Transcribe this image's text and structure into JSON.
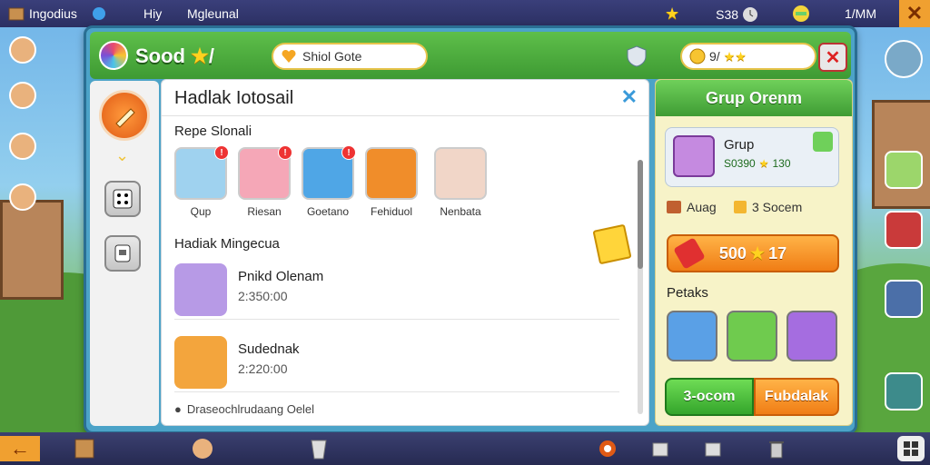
{
  "topbar": {
    "left_label": "Ingodius",
    "mid_label": "Hiy",
    "center_label": "Mgleunal",
    "currency_a": "S38",
    "currency_b": "1/MM"
  },
  "header": {
    "title": "Sood",
    "title_suffix": "/",
    "search_text": "Shiol Gote",
    "coin_text": "9/"
  },
  "main": {
    "title": "Hadlak Iotosail",
    "section1": "Repe Slonali",
    "cards": [
      {
        "label": "Qup",
        "color": "#9fd2ef"
      },
      {
        "label": "Riesan",
        "color": "#f5a7b7"
      },
      {
        "label": "Goetano",
        "color": "#4fa6e6"
      },
      {
        "label": "Fehiduol",
        "color": "#f08d2a"
      },
      {
        "label": "Nenbata",
        "color": "#f1d6c8"
      }
    ],
    "section2": "Hadiak Mingecua",
    "rows": [
      {
        "name": "Pnikd Olenam",
        "sub": "2:350:00"
      },
      {
        "name": "Sudednak",
        "sub": "2:220:00"
      }
    ],
    "footer": "Draseochlrudaang Oelel"
  },
  "right": {
    "title": "Grup Orenm",
    "card_name": "Grup",
    "card_value": "S0390",
    "card_value2": "130",
    "res1": "Auag",
    "res2": "3 Socem",
    "buy_price": "500",
    "buy_suffix": "17",
    "section": "Petaks",
    "btn_green": "3-ocom",
    "btn_orange": "Fubdalak"
  },
  "colors": {
    "panel": "#4ca3c8",
    "header": "#3e9a33",
    "accent_orange": "#f07d15",
    "accent_green": "#34a52b"
  }
}
